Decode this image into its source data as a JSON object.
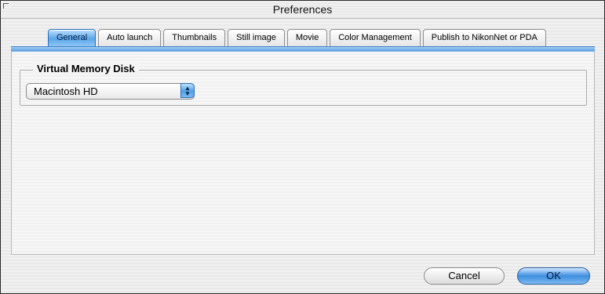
{
  "window": {
    "title": "Preferences"
  },
  "tabs": [
    {
      "label": "General",
      "active": true
    },
    {
      "label": "Auto launch",
      "active": false
    },
    {
      "label": "Thumbnails",
      "active": false
    },
    {
      "label": "Still image",
      "active": false
    },
    {
      "label": "Movie",
      "active": false
    },
    {
      "label": "Color Management",
      "active": false
    },
    {
      "label": "Publish to NikonNet or PDA",
      "active": false
    }
  ],
  "general": {
    "group_title": "Virtual Memory Disk",
    "disk_select": {
      "value": "Macintosh HD",
      "icon": "up-down-arrows-icon"
    }
  },
  "footer": {
    "cancel_label": "Cancel",
    "ok_label": "OK"
  },
  "colors": {
    "accent": "#4f9de8",
    "accent_border": "#2a6fba"
  }
}
